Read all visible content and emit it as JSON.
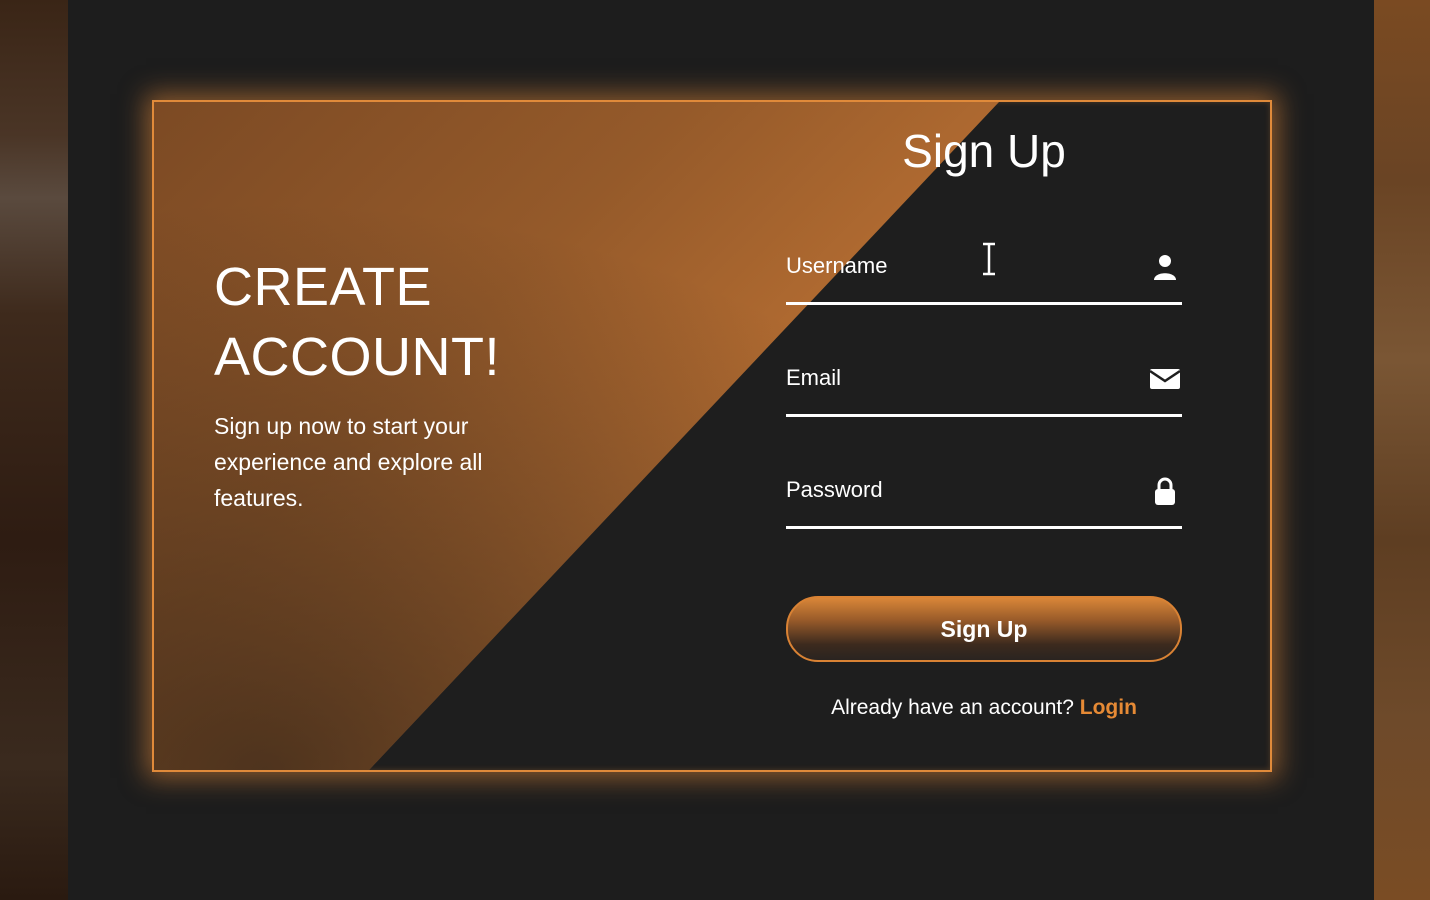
{
  "theme": {
    "accent": "#e08a3a",
    "background": "#1e1e1e",
    "text": "#ffffff",
    "link": "#e68a35"
  },
  "hero": {
    "headline_line1": "CREATE",
    "headline_line2": "ACCOUNT!",
    "subtext": "Sign up now to start your experience and explore all features."
  },
  "form": {
    "title": "Sign Up",
    "fields": [
      {
        "label": "Username",
        "icon": "user-icon"
      },
      {
        "label": "Email",
        "icon": "envelope-icon"
      },
      {
        "label": "Password",
        "icon": "lock-icon"
      }
    ],
    "submit_label": "Sign Up",
    "footer_text": "Already have an account?",
    "login_label": "Login"
  }
}
